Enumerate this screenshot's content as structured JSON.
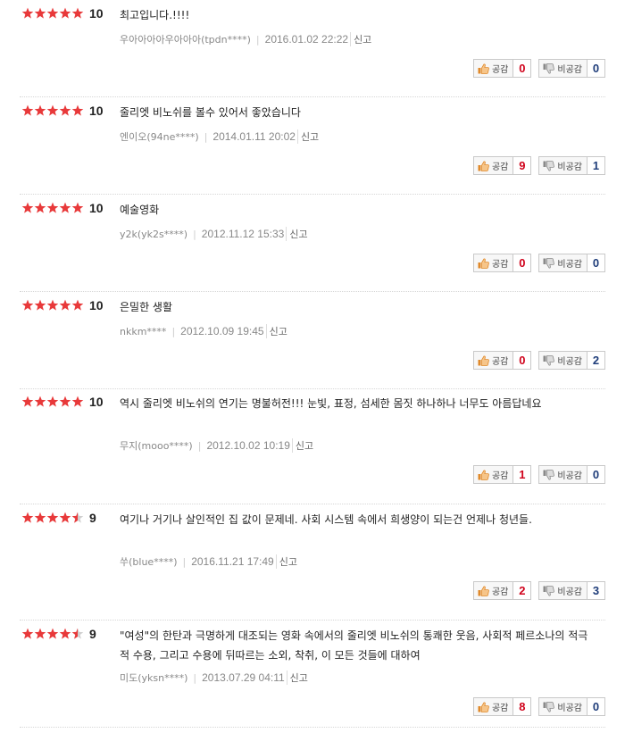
{
  "reviews": [
    {
      "stars": 5,
      "score": "10",
      "text": "최고입니다.!!!!",
      "user": "우아아아아우아아아(tpdn****)",
      "date": "2016.01.02 22:22",
      "report": "신고",
      "like_label": "공감",
      "likes": "0",
      "dislike_label": "비공감",
      "dislikes": "0"
    },
    {
      "stars": 5,
      "score": "10",
      "text": "줄리엣 비노쉬를 볼수 있어서 좋았습니다",
      "user": "엔이오(94ne****)",
      "date": "2014.01.11 20:02",
      "report": "신고",
      "like_label": "공감",
      "likes": "9",
      "dislike_label": "비공감",
      "dislikes": "1"
    },
    {
      "stars": 5,
      "score": "10",
      "text": "예술영화",
      "user": "y2k(yk2s****)",
      "date": "2012.11.12 15:33",
      "report": "신고",
      "like_label": "공감",
      "likes": "0",
      "dislike_label": "비공감",
      "dislikes": "0"
    },
    {
      "stars": 5,
      "score": "10",
      "text": "은밀한 생활",
      "user": "nkkm****",
      "date": "2012.10.09 19:45",
      "report": "신고",
      "like_label": "공감",
      "likes": "0",
      "dislike_label": "비공감",
      "dislikes": "2"
    },
    {
      "stars": 5,
      "score": "10",
      "text": "역시 줄리엣 비노쉬의 연기는 명불허전!!! 눈빛, 표정, 섬세한 몸짓 하나하나 너무도 아름답네요",
      "user": "무지(mooo****)",
      "date": "2012.10.02 10:19",
      "report": "신고",
      "like_label": "공감",
      "likes": "1",
      "dislike_label": "비공감",
      "dislikes": "0"
    },
    {
      "stars": 4.5,
      "score": "9",
      "text": "여기나 거기나 살인적인 집 값이 문제네. 사회 시스템 속에서 희생양이 되는건 언제나 청년들.",
      "user": "쑤(blue****)",
      "date": "2016.11.21 17:49",
      "report": "신고",
      "like_label": "공감",
      "likes": "2",
      "dislike_label": "비공감",
      "dislikes": "3"
    },
    {
      "stars": 4.5,
      "score": "9",
      "text": "\"여성\"의 한탄과 극명하게 대조되는 영화 속에서의 줄리엣 비노쉬의 통쾌한 웃음, 사회적 페르소나의 적극적 수용, 그리고 수용에 뒤따르는 소외, 착취, 이 모든 것들에 대하여",
      "user": "미도(yksn****)",
      "date": "2013.07.29 04:11",
      "report": "신고",
      "like_label": "공감",
      "likes": "8",
      "dislike_label": "비공감",
      "dislikes": "0"
    }
  ],
  "colors": {
    "star": "#e8393a",
    "star_empty": "#cfcfcf",
    "like_count": "#d0021b",
    "dislike_count": "#1f3d7a",
    "like_icon": "#e0892a"
  },
  "icons": {
    "like": "thumbs-up-icon",
    "dislike": "thumbs-down-icon",
    "star": "star-icon"
  }
}
